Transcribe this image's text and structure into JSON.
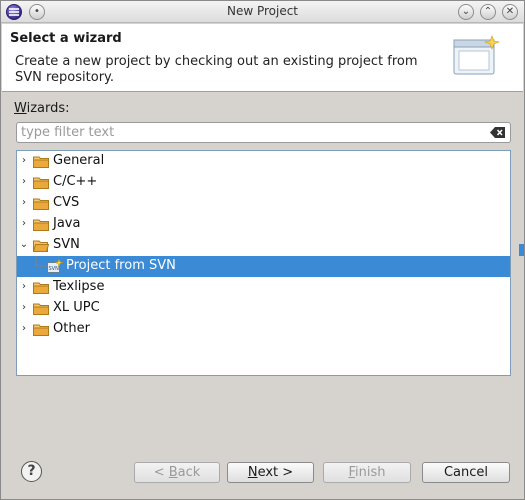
{
  "window": {
    "title": "New Project"
  },
  "banner": {
    "title": "Select a wizard",
    "description": "Create a new project by checking out an existing project from SVN repository."
  },
  "wizards": {
    "label_prefix": "W",
    "label_rest": "izards:",
    "filter_placeholder": "type filter text",
    "filter_value": ""
  },
  "tree": {
    "items": [
      {
        "label": "General",
        "expanded": false
      },
      {
        "label": "C/C++",
        "expanded": false
      },
      {
        "label": "CVS",
        "expanded": false
      },
      {
        "label": "Java",
        "expanded": false
      },
      {
        "label": "SVN",
        "expanded": true
      },
      {
        "label": "Project from SVN",
        "selected": true,
        "child": true
      },
      {
        "label": "Texlipse",
        "expanded": false
      },
      {
        "label": "XL UPC",
        "expanded": false
      },
      {
        "label": "Other",
        "expanded": false
      }
    ]
  },
  "buttons": {
    "help": "?",
    "back_prefix": "< ",
    "back_key": "B",
    "back_rest": "ack",
    "next_key": "N",
    "next_rest": "ext >",
    "finish_key": "F",
    "finish_rest": "inish",
    "cancel": "Cancel"
  },
  "colors": {
    "selection": "#3a8ad6",
    "folder": "#e8a33c"
  }
}
